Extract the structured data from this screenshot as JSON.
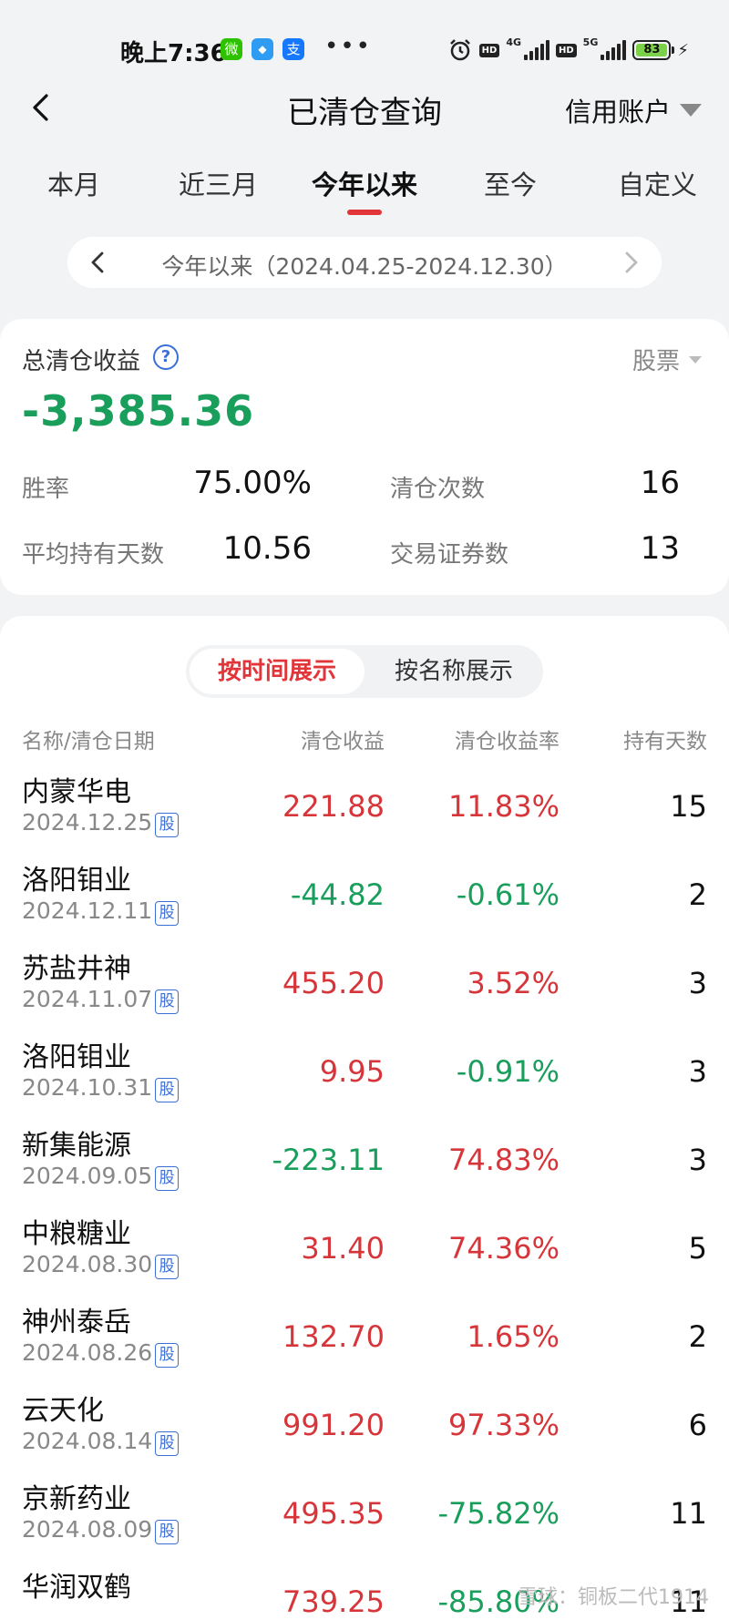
{
  "status_bar": {
    "time": "晚上7:36",
    "apps": [
      "微",
      "◆",
      "支"
    ],
    "dots": "•••",
    "hd": "HD",
    "net1": "4G",
    "net2": "5G",
    "battery": "83"
  },
  "nav": {
    "title": "已清仓查询",
    "account": "信用账户"
  },
  "tabs": [
    {
      "label": "本月"
    },
    {
      "label": "近三月"
    },
    {
      "label": "今年以来"
    },
    {
      "label": "至今"
    },
    {
      "label": "自定义"
    }
  ],
  "range": {
    "text": "今年以来（2024.04.25-2024.12.30）"
  },
  "summary": {
    "label": "总清仓收益",
    "type": "股票",
    "value": "-3,385.36",
    "win_rate_label": "胜率",
    "win_rate": "75.00%",
    "count_label": "清仓次数",
    "count": "16",
    "avg_days_label": "平均持有天数",
    "avg_days": "10.56",
    "securities_label": "交易证券数",
    "securities": "13"
  },
  "list": {
    "toggle_time": "按时间展示",
    "toggle_name": "按名称展示",
    "headers": [
      "名称/清仓日期",
      "清仓收益",
      "清仓收益率",
      "持有天数"
    ],
    "badge": "股",
    "rows": [
      {
        "name": "内蒙华电",
        "date": "2024.12.25",
        "pnl": "221.88",
        "rate": "11.83%",
        "days": "15"
      },
      {
        "name": "洛阳钼业",
        "date": "2024.12.11",
        "pnl": "-44.82",
        "rate": "-0.61%",
        "days": "2"
      },
      {
        "name": "苏盐井神",
        "date": "2024.11.07",
        "pnl": "455.20",
        "rate": "3.52%",
        "days": "3"
      },
      {
        "name": "洛阳钼业",
        "date": "2024.10.31",
        "pnl": "9.95",
        "rate": "-0.91%",
        "days": "3"
      },
      {
        "name": "新集能源",
        "date": "2024.09.05",
        "pnl": "-223.11",
        "rate": "74.83%",
        "days": "3"
      },
      {
        "name": "中粮糖业",
        "date": "2024.08.30",
        "pnl": "31.40",
        "rate": "74.36%",
        "days": "5"
      },
      {
        "name": "神州泰岳",
        "date": "2024.08.26",
        "pnl": "132.70",
        "rate": "1.65%",
        "days": "2"
      },
      {
        "name": "云天化",
        "date": "2024.08.14",
        "pnl": "991.20",
        "rate": "97.33%",
        "days": "6"
      },
      {
        "name": "京新药业",
        "date": "2024.08.09",
        "pnl": "495.35",
        "rate": "-75.82%",
        "days": "11"
      },
      {
        "name": "华润双鹤",
        "date": "",
        "pnl": "739.25",
        "rate": "-85.80%",
        "days": "11"
      }
    ]
  },
  "watermark": "雪球：铜板二代1914",
  "colors": {
    "gain": "#d6353a",
    "loss": "#1a9e5c",
    "accent": "#e2353a",
    "link": "#3b6fd8"
  }
}
